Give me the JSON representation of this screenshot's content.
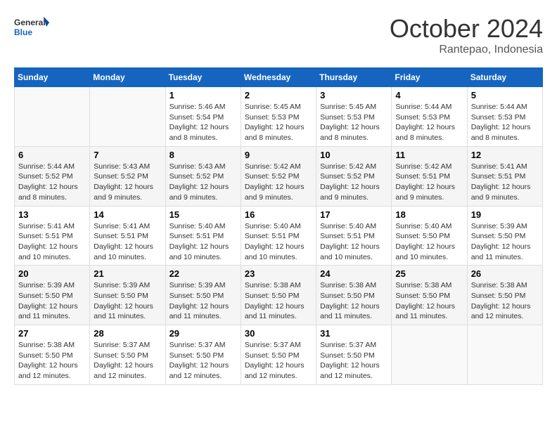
{
  "logo": {
    "general": "General",
    "blue": "Blue"
  },
  "header": {
    "month": "October 2024",
    "location": "Rantepao, Indonesia"
  },
  "weekdays": [
    "Sunday",
    "Monday",
    "Tuesday",
    "Wednesday",
    "Thursday",
    "Friday",
    "Saturday"
  ],
  "weeks": [
    [
      {
        "day": null,
        "info": null
      },
      {
        "day": null,
        "info": null
      },
      {
        "day": "1",
        "sunrise": "5:46 AM",
        "sunset": "5:54 PM",
        "daylight": "12 hours and 8 minutes."
      },
      {
        "day": "2",
        "sunrise": "5:45 AM",
        "sunset": "5:53 PM",
        "daylight": "12 hours and 8 minutes."
      },
      {
        "day": "3",
        "sunrise": "5:45 AM",
        "sunset": "5:53 PM",
        "daylight": "12 hours and 8 minutes."
      },
      {
        "day": "4",
        "sunrise": "5:44 AM",
        "sunset": "5:53 PM",
        "daylight": "12 hours and 8 minutes."
      },
      {
        "day": "5",
        "sunrise": "5:44 AM",
        "sunset": "5:53 PM",
        "daylight": "12 hours and 8 minutes."
      }
    ],
    [
      {
        "day": "6",
        "sunrise": "5:44 AM",
        "sunset": "5:52 PM",
        "daylight": "12 hours and 8 minutes."
      },
      {
        "day": "7",
        "sunrise": "5:43 AM",
        "sunset": "5:52 PM",
        "daylight": "12 hours and 9 minutes."
      },
      {
        "day": "8",
        "sunrise": "5:43 AM",
        "sunset": "5:52 PM",
        "daylight": "12 hours and 9 minutes."
      },
      {
        "day": "9",
        "sunrise": "5:42 AM",
        "sunset": "5:52 PM",
        "daylight": "12 hours and 9 minutes."
      },
      {
        "day": "10",
        "sunrise": "5:42 AM",
        "sunset": "5:52 PM",
        "daylight": "12 hours and 9 minutes."
      },
      {
        "day": "11",
        "sunrise": "5:42 AM",
        "sunset": "5:51 PM",
        "daylight": "12 hours and 9 minutes."
      },
      {
        "day": "12",
        "sunrise": "5:41 AM",
        "sunset": "5:51 PM",
        "daylight": "12 hours and 9 minutes."
      }
    ],
    [
      {
        "day": "13",
        "sunrise": "5:41 AM",
        "sunset": "5:51 PM",
        "daylight": "12 hours and 10 minutes."
      },
      {
        "day": "14",
        "sunrise": "5:41 AM",
        "sunset": "5:51 PM",
        "daylight": "12 hours and 10 minutes."
      },
      {
        "day": "15",
        "sunrise": "5:40 AM",
        "sunset": "5:51 PM",
        "daylight": "12 hours and 10 minutes."
      },
      {
        "day": "16",
        "sunrise": "5:40 AM",
        "sunset": "5:51 PM",
        "daylight": "12 hours and 10 minutes."
      },
      {
        "day": "17",
        "sunrise": "5:40 AM",
        "sunset": "5:51 PM",
        "daylight": "12 hours and 10 minutes."
      },
      {
        "day": "18",
        "sunrise": "5:40 AM",
        "sunset": "5:50 PM",
        "daylight": "12 hours and 10 minutes."
      },
      {
        "day": "19",
        "sunrise": "5:39 AM",
        "sunset": "5:50 PM",
        "daylight": "12 hours and 11 minutes."
      }
    ],
    [
      {
        "day": "20",
        "sunrise": "5:39 AM",
        "sunset": "5:50 PM",
        "daylight": "12 hours and 11 minutes."
      },
      {
        "day": "21",
        "sunrise": "5:39 AM",
        "sunset": "5:50 PM",
        "daylight": "12 hours and 11 minutes."
      },
      {
        "day": "22",
        "sunrise": "5:39 AM",
        "sunset": "5:50 PM",
        "daylight": "12 hours and 11 minutes."
      },
      {
        "day": "23",
        "sunrise": "5:38 AM",
        "sunset": "5:50 PM",
        "daylight": "12 hours and 11 minutes."
      },
      {
        "day": "24",
        "sunrise": "5:38 AM",
        "sunset": "5:50 PM",
        "daylight": "12 hours and 11 minutes."
      },
      {
        "day": "25",
        "sunrise": "5:38 AM",
        "sunset": "5:50 PM",
        "daylight": "12 hours and 11 minutes."
      },
      {
        "day": "26",
        "sunrise": "5:38 AM",
        "sunset": "5:50 PM",
        "daylight": "12 hours and 12 minutes."
      }
    ],
    [
      {
        "day": "27",
        "sunrise": "5:38 AM",
        "sunset": "5:50 PM",
        "daylight": "12 hours and 12 minutes."
      },
      {
        "day": "28",
        "sunrise": "5:37 AM",
        "sunset": "5:50 PM",
        "daylight": "12 hours and 12 minutes."
      },
      {
        "day": "29",
        "sunrise": "5:37 AM",
        "sunset": "5:50 PM",
        "daylight": "12 hours and 12 minutes."
      },
      {
        "day": "30",
        "sunrise": "5:37 AM",
        "sunset": "5:50 PM",
        "daylight": "12 hours and 12 minutes."
      },
      {
        "day": "31",
        "sunrise": "5:37 AM",
        "sunset": "5:50 PM",
        "daylight": "12 hours and 12 minutes."
      },
      {
        "day": null,
        "info": null
      },
      {
        "day": null,
        "info": null
      }
    ]
  ],
  "labels": {
    "sunrise": "Sunrise:",
    "sunset": "Sunset:",
    "daylight": "Daylight:"
  }
}
